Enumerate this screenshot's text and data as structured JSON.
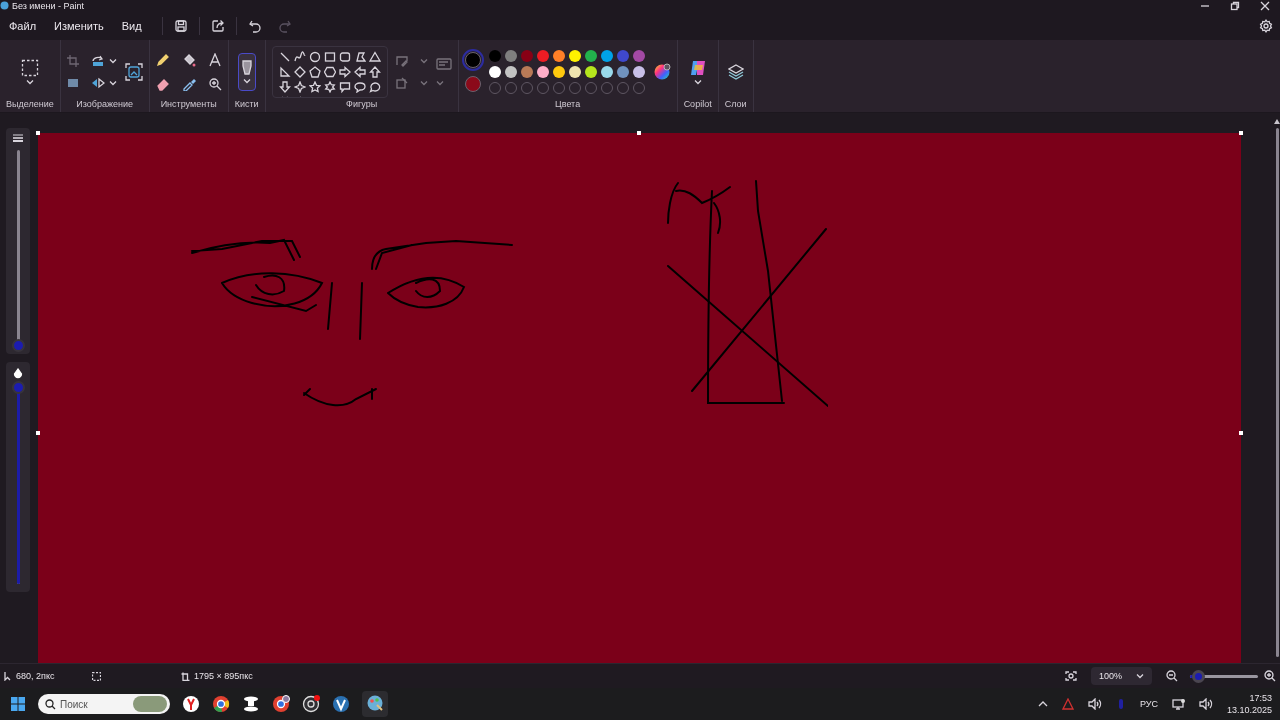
{
  "window": {
    "title": "Без имени - Paint"
  },
  "menu": [
    "Файл",
    "Изменить",
    "Вид"
  ],
  "ribbon": {
    "groups": [
      {
        "kind": "selection",
        "label": "Выделение"
      },
      {
        "kind": "image",
        "label": "Изображение"
      },
      {
        "kind": "tools",
        "label": "Инструменты"
      },
      {
        "kind": "brushes",
        "label": "Кисти"
      },
      {
        "kind": "shapes",
        "label": "Фигуры"
      },
      {
        "kind": "colors",
        "label": "Цвета"
      },
      {
        "kind": "copilot",
        "label": "Copilot"
      },
      {
        "kind": "layers",
        "label": "Слои"
      }
    ]
  },
  "brushes": {
    "selected": true
  },
  "colors": {
    "primary": {
      "color": "#000000",
      "selected": true
    },
    "secondary": {
      "color": "#8b0a1a",
      "selected": false
    },
    "palette": [
      {
        "kind": "swatch",
        "color": "#000000"
      },
      {
        "kind": "swatch",
        "color": "#7f7f7f"
      },
      {
        "kind": "swatch",
        "color": "#880015"
      },
      {
        "kind": "swatch",
        "color": "#ed1c24"
      },
      {
        "kind": "swatch",
        "color": "#ff7f27"
      },
      {
        "kind": "swatch",
        "color": "#fff200"
      },
      {
        "kind": "swatch",
        "color": "#22b14c"
      },
      {
        "kind": "swatch",
        "color": "#00a2e8"
      },
      {
        "kind": "swatch",
        "color": "#3f48cc"
      },
      {
        "kind": "swatch",
        "color": "#a349a4"
      },
      {
        "kind": "swatch",
        "color": "#ffffff"
      },
      {
        "kind": "swatch",
        "color": "#c3c3c3"
      },
      {
        "kind": "swatch",
        "color": "#b97a57"
      },
      {
        "kind": "swatch",
        "color": "#ffaec9"
      },
      {
        "kind": "swatch",
        "color": "#ffc90e"
      },
      {
        "kind": "swatch",
        "color": "#efe4b0"
      },
      {
        "kind": "swatch",
        "color": "#b5e61d"
      },
      {
        "kind": "swatch",
        "color": "#99d9ea"
      },
      {
        "kind": "swatch",
        "color": "#7092be"
      },
      {
        "kind": "swatch",
        "color": "#c8bfe7"
      },
      {
        "kind": "empty"
      },
      {
        "kind": "empty"
      },
      {
        "kind": "empty"
      },
      {
        "kind": "empty"
      },
      {
        "kind": "empty"
      },
      {
        "kind": "empty"
      },
      {
        "kind": "empty"
      },
      {
        "kind": "empty"
      },
      {
        "kind": "empty"
      },
      {
        "kind": "empty"
      }
    ]
  },
  "side_panel": {
    "size_slider": {
      "level": 0
    },
    "opacity_slider": {
      "level": 1
    }
  },
  "status_bar": {
    "cursor_position": "680, 2пкс",
    "canvas_size": "1795 × 895пкс",
    "zoom": "100%",
    "zoom_slider": {
      "level": 0.12
    }
  },
  "taskbar": {
    "search": {
      "placeholder": "Поиск"
    },
    "language": "РУС",
    "time": "17:53",
    "date": "13.10.2025"
  }
}
